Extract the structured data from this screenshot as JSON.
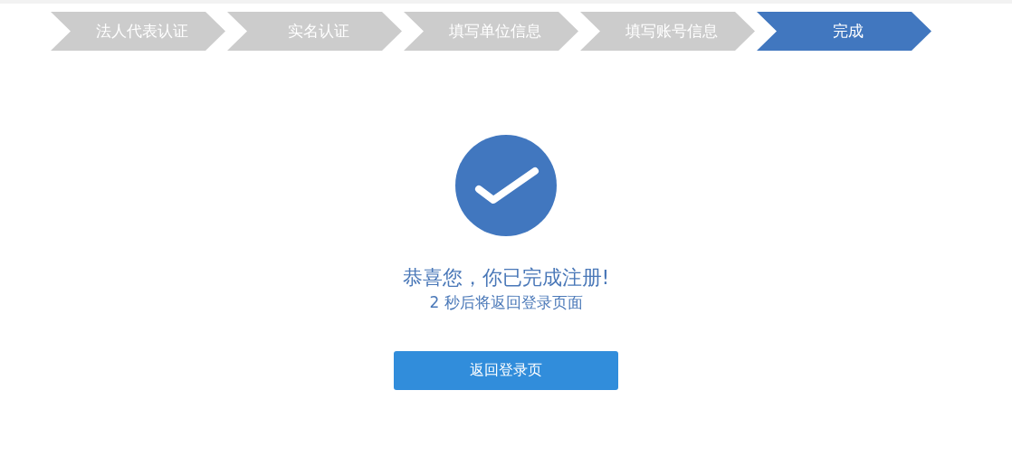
{
  "steps": [
    {
      "label": "法人代表认证",
      "selected": false
    },
    {
      "label": "实名认证",
      "selected": false
    },
    {
      "label": "填写单位信息",
      "selected": false
    },
    {
      "label": "填写账号信息",
      "selected": false
    },
    {
      "label": "完成",
      "selected": true
    }
  ],
  "result": {
    "title": "恭喜您，你已完成注册!",
    "subtitle": "2 秒后将返回登录页面",
    "button": "返回登录页"
  }
}
